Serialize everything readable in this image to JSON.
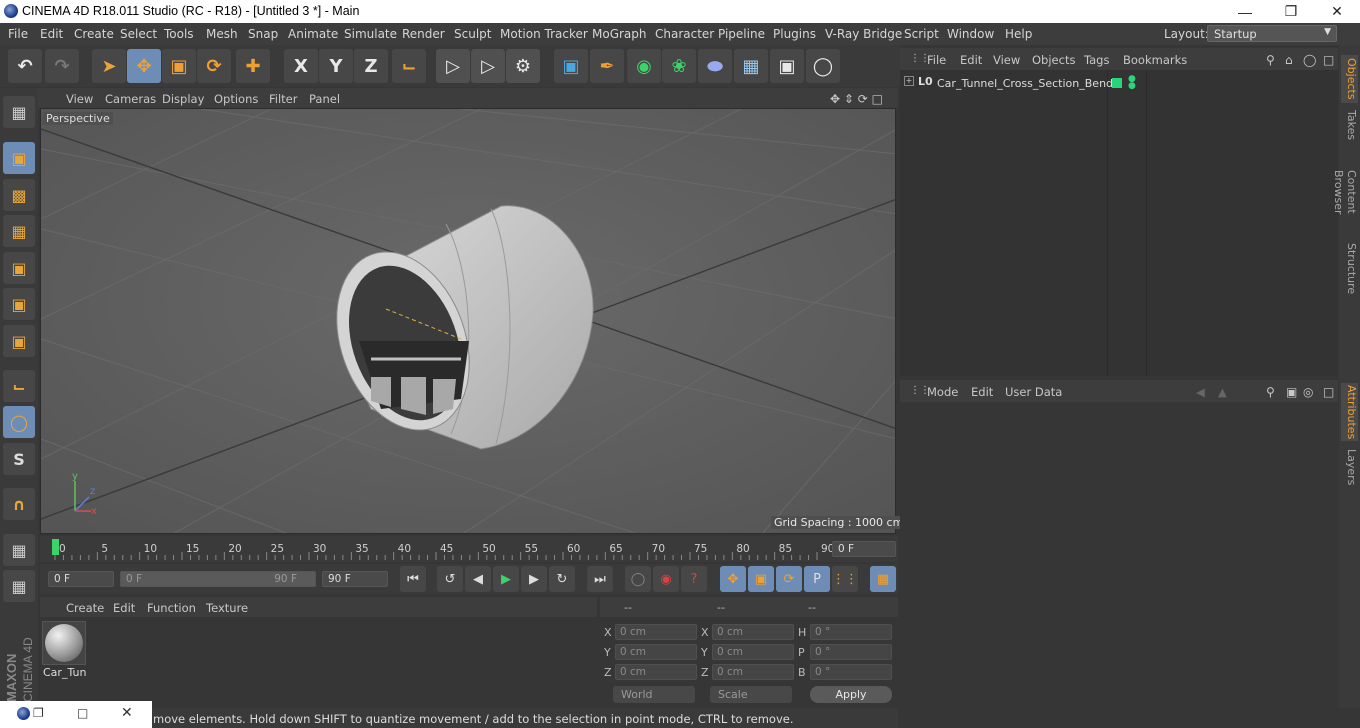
{
  "window": {
    "title": "CINEMA 4D R18.011 Studio (RC - R18) - [Untitled 3 *] - Main"
  },
  "menubar": {
    "items": [
      "File",
      "Edit",
      "Create",
      "Select",
      "Tools",
      "Mesh",
      "Snap",
      "Animate",
      "Simulate",
      "Render",
      "Sculpt",
      "Motion Tracker",
      "MoGraph",
      "Character",
      "Pipeline",
      "Plugins",
      "V-Ray Bridge",
      "Script",
      "Window",
      "Help"
    ],
    "layout_label": "Layout:",
    "layout_value": "Startup"
  },
  "toolbar": {
    "undo_icon": "undo-icon",
    "axis_x": "X",
    "axis_y": "Y",
    "axis_z": "Z"
  },
  "viewport": {
    "menu": [
      "View",
      "Cameras",
      "Display",
      "Options",
      "Filter",
      "Panel"
    ],
    "view_name": "Perspective",
    "grid_spacing": "Grid Spacing : 1000 cm",
    "axis_labels": {
      "x": "x",
      "y": "y",
      "z": "z"
    }
  },
  "timeline": {
    "ticks": [
      "0",
      "5",
      "10",
      "15",
      "20",
      "25",
      "30",
      "35",
      "40",
      "45",
      "50",
      "55",
      "60",
      "65",
      "70",
      "75",
      "80",
      "85",
      "90"
    ],
    "current_frame": "0 F",
    "start_frame": "0 F",
    "range_start": "0 F",
    "range_end": "90 F",
    "end_frame": "90 F"
  },
  "material_manager": {
    "menu": [
      "Create",
      "Edit",
      "Function",
      "Texture"
    ],
    "material_name": "Car_Tun"
  },
  "coordinates": {
    "headers": [
      "--",
      "--",
      "--"
    ],
    "pos": {
      "x": "0 cm",
      "y": "0 cm",
      "z": "0 cm"
    },
    "size": {
      "x": "0 cm",
      "y": "0 cm",
      "z": "0 cm"
    },
    "rot": {
      "h": "0 °",
      "p": "0 °",
      "b": "0 °"
    },
    "labels": {
      "x": "X",
      "y": "Y",
      "z": "Z",
      "h": "H",
      "p": "P",
      "b": "B"
    },
    "mode_world": "World",
    "mode_scale": "Scale",
    "apply_label": "Apply"
  },
  "object_manager": {
    "menu": [
      "File",
      "Edit",
      "View",
      "Objects",
      "Tags",
      "Bookmarks"
    ],
    "objects": [
      {
        "name": "Car_Tunnel_Cross_Section_Bend",
        "layer_icon": "L0"
      }
    ]
  },
  "attribute_manager": {
    "menu": [
      "Mode",
      "Edit",
      "User Data"
    ]
  },
  "right_tabs": {
    "objects": "Objects",
    "takes": "Takes",
    "content_browser": "Content Browser",
    "structure": "Structure",
    "attributes": "Attributes",
    "layers": "Layers"
  },
  "status_bar": {
    "text": "move elements. Hold down SHIFT to quantize movement / add to the selection in point mode, CTRL to remove."
  },
  "branding": {
    "maxon": "MAXON",
    "cinema": "CINEMA 4D"
  },
  "colors": {
    "accent_orange": "#f0a030",
    "selected_blue": "#6e8db6",
    "object_green": "#2bd37a"
  }
}
